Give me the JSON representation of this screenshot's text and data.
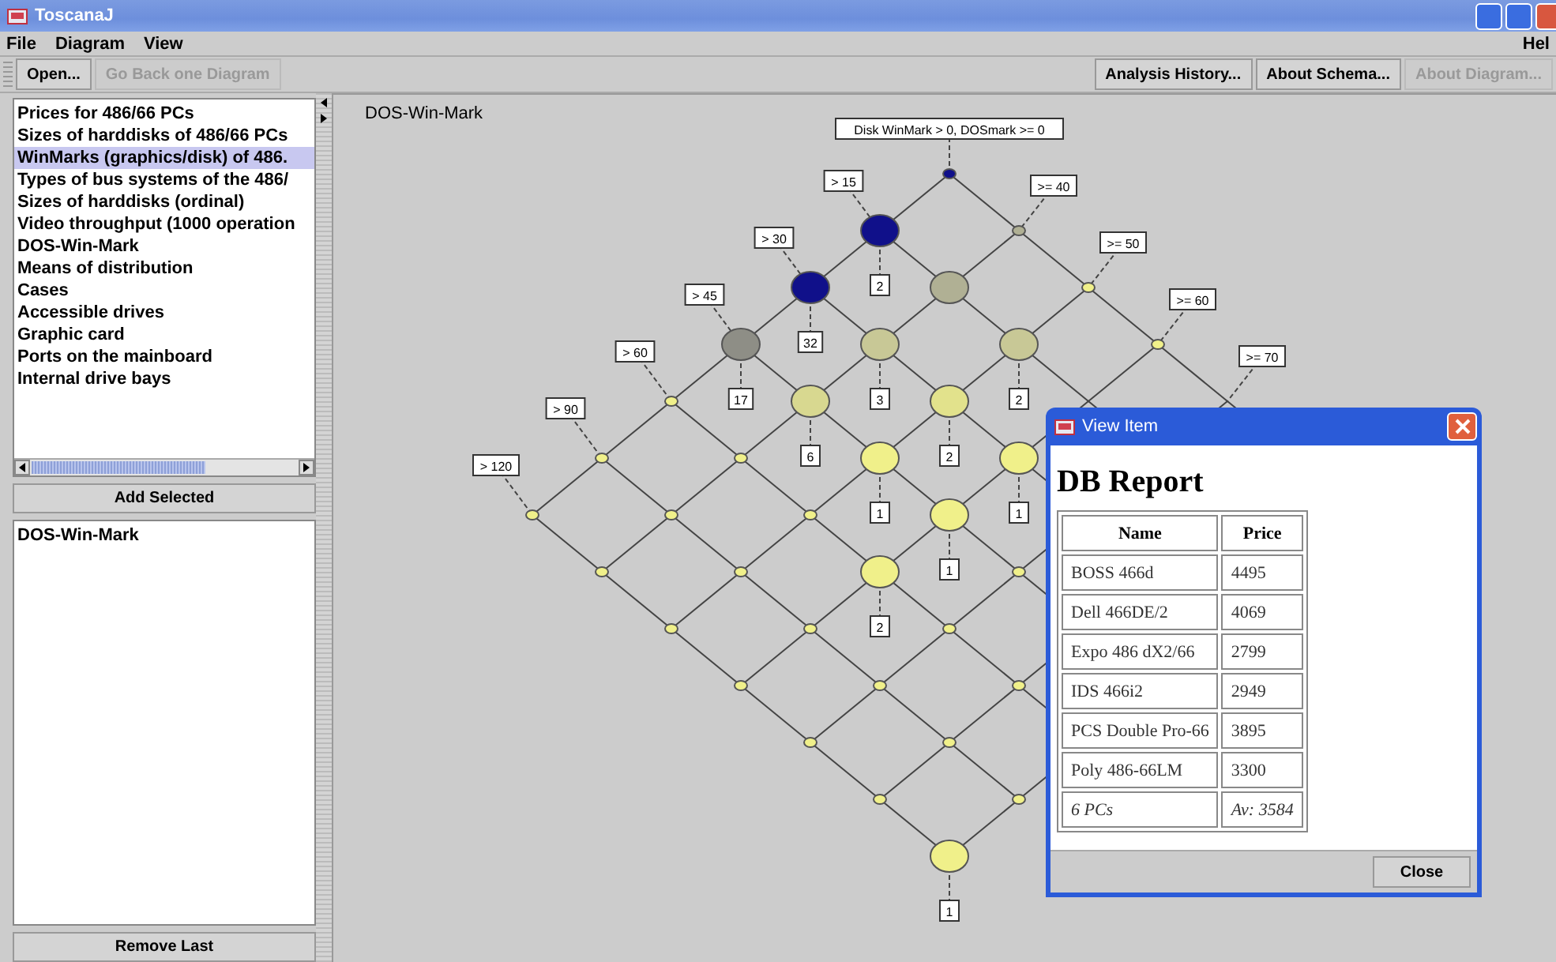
{
  "window": {
    "title": "ToscanaJ"
  },
  "menu": [
    {
      "label": "File"
    },
    {
      "label": "Diagram"
    },
    {
      "label": "View"
    }
  ],
  "help_menu": {
    "label": "Hel"
  },
  "toolbar_left": [
    {
      "label": "Open...",
      "disabled": false
    },
    {
      "label": "Go Back one Diagram",
      "disabled": true
    }
  ],
  "toolbar_right": [
    {
      "label": "Analysis History...",
      "disabled": false
    },
    {
      "label": "About Schema...",
      "disabled": false
    },
    {
      "label": "About Diagram...",
      "disabled": true
    }
  ],
  "diagram_list": [
    {
      "label": "Prices for 486/66 PCs",
      "selected": false
    },
    {
      "label": "Sizes of harddisks of 486/66 PCs",
      "selected": false
    },
    {
      "label": "WinMarks (graphics/disk) of 486.",
      "selected": true
    },
    {
      "label": "Types of bus systems of the 486/",
      "selected": false
    },
    {
      "label": "Sizes of harddisks (ordinal)",
      "selected": false
    },
    {
      "label": "Video throughput (1000 operation",
      "selected": false
    },
    {
      "label": "DOS-Win-Mark",
      "selected": false
    },
    {
      "label": "Means of distribution",
      "selected": false
    },
    {
      "label": "Cases",
      "selected": false
    },
    {
      "label": "Accessible drives",
      "selected": false
    },
    {
      "label": "Graphic card",
      "selected": false
    },
    {
      "label": "Ports on the mainboard",
      "selected": false
    },
    {
      "label": "Internal drive bays",
      "selected": false
    }
  ],
  "add_button": "Add Selected",
  "history_list": [
    {
      "label": "DOS-Win-Mark",
      "selected": false
    }
  ],
  "remove_button": "Remove Last",
  "diagram": {
    "title": "DOS-Win-Mark",
    "top_label": "Disk WinMark > 0, DOSmark >= 0",
    "left_labels": [
      "> 15",
      "> 30",
      "> 45",
      "> 60",
      "> 90",
      "> 120"
    ],
    "right_labels": [
      ">= 40",
      ">= 50",
      ">= 60",
      ">= 70"
    ],
    "lattice": [
      [
        {
          "kind": "small",
          "color": "#10108a"
        },
        {
          "kind": "small",
          "color": "#b0b094"
        },
        {
          "kind": "small",
          "color": "#f0f08a"
        },
        {
          "kind": "small",
          "color": "#f0f08a"
        }
      ],
      [
        {
          "kind": "large",
          "color": "#10108a",
          "count": "2"
        },
        {
          "kind": "large",
          "color": "#b0b094"
        },
        {
          "kind": "large",
          "color": "#c8c896",
          "count": "2"
        }
      ],
      [
        {
          "kind": "large",
          "color": "#10108a",
          "count": "32"
        },
        {
          "kind": "large",
          "color": "#c8c896",
          "count": "3"
        },
        {
          "kind": "large",
          "color": "#e2e28c",
          "count": "2"
        },
        {
          "kind": "large",
          "color": "#f0f08a",
          "count": "1"
        }
      ],
      [
        {
          "kind": "large",
          "color": "#8e8e86",
          "count": "17"
        },
        {
          "kind": "large",
          "color": "#d8d890",
          "count": "6"
        },
        {
          "kind": "large",
          "color": "#f0f08a",
          "count": "1"
        },
        {
          "kind": "large",
          "color": "#f0f08a",
          "count": "1"
        },
        {
          "kind": "small",
          "color": "#f0f08a"
        }
      ],
      [
        {
          "kind": "small",
          "color": "#f0f08a"
        },
        {
          "kind": "small",
          "color": "#f0f08a"
        },
        {
          "kind": "small",
          "color": "#f0f08a"
        },
        {
          "kind": "large",
          "color": "#f0f08a",
          "count": "2"
        },
        {
          "kind": "small",
          "color": "#f0f08a"
        },
        {
          "kind": "small",
          "color": "#f0f08a"
        }
      ],
      [
        {
          "kind": "small",
          "color": "#f0f08a"
        },
        {
          "kind": "small",
          "color": "#f0f08a"
        },
        {
          "kind": "small",
          "color": "#f0f08a"
        },
        {
          "kind": "small",
          "color": "#f0f08a"
        },
        {
          "kind": "small",
          "color": "#f0f08a"
        },
        {
          "kind": "small",
          "color": "#f0f08a"
        },
        {
          "kind": "small",
          "color": "#f0f08a"
        }
      ],
      [
        {
          "kind": "small",
          "color": "#f0f08a"
        },
        {
          "kind": "small",
          "color": "#f0f08a"
        },
        {
          "kind": "small",
          "color": "#f0f08a"
        },
        {
          "kind": "small",
          "color": "#f0f08a"
        },
        {
          "kind": "small",
          "color": "#f0f08a"
        },
        {
          "kind": "small",
          "color": "#f0f08a"
        },
        {
          "kind": "large",
          "color": "#f0f08a",
          "count": "1"
        }
      ]
    ]
  },
  "dialog": {
    "title": "View Item",
    "heading": "DB Report",
    "columns": [
      "Name",
      "Price"
    ],
    "rows": [
      {
        "kind": "item",
        "cells": [
          "BOSS 466d",
          "4495"
        ]
      },
      {
        "kind": "item",
        "cells": [
          "Dell 466DE/2",
          "4069"
        ]
      },
      {
        "kind": "item",
        "cells": [
          "Expo 486 dX2/66",
          "2799"
        ]
      },
      {
        "kind": "item",
        "cells": [
          "IDS 466i2",
          "2949"
        ]
      },
      {
        "kind": "item",
        "cells": [
          "PCS Double Pro-66",
          "3895"
        ]
      },
      {
        "kind": "item",
        "cells": [
          "Poly 486-66LM",
          "3300"
        ]
      },
      {
        "kind": "summary",
        "cells": [
          "6  PCs",
          "Av:  3584"
        ]
      }
    ],
    "button": "Close"
  }
}
